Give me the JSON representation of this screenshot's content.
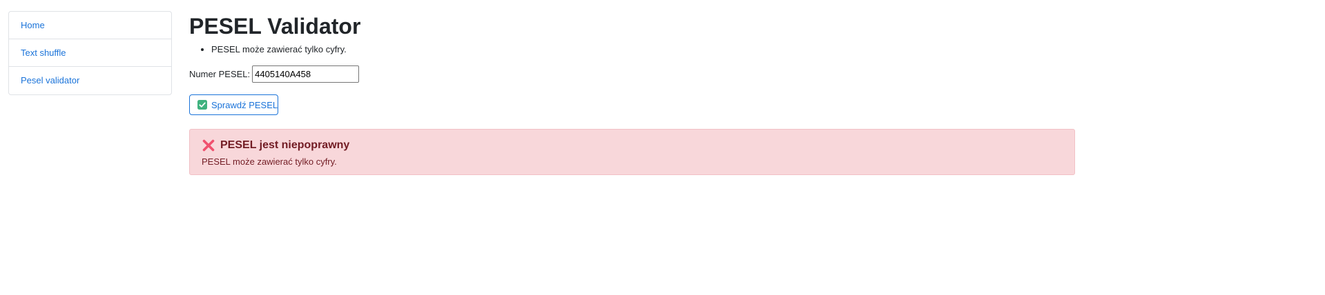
{
  "sidebar": {
    "items": [
      {
        "label": "Home"
      },
      {
        "label": "Text shuffle"
      },
      {
        "label": "Pesel validator"
      }
    ]
  },
  "main": {
    "title": "PESEL Validator",
    "errors": [
      "PESEL może zawierać tylko cyfry."
    ],
    "field": {
      "label": "Numer PESEL:",
      "value": "4405140A458"
    },
    "check_button": {
      "label": "Sprawdź PESEL",
      "icon": "check-mark-button-icon"
    },
    "alert": {
      "icon": "cross-mark-icon",
      "heading": "PESEL jest niepoprawny",
      "text": "PESEL może zawierać tylko cyfry."
    }
  },
  "colors": {
    "link": "#1a73d9",
    "alert_bg": "#f8d7da",
    "alert_text": "#721c24",
    "check_green": "#3fb27f",
    "cross_red": "#f0506e"
  }
}
